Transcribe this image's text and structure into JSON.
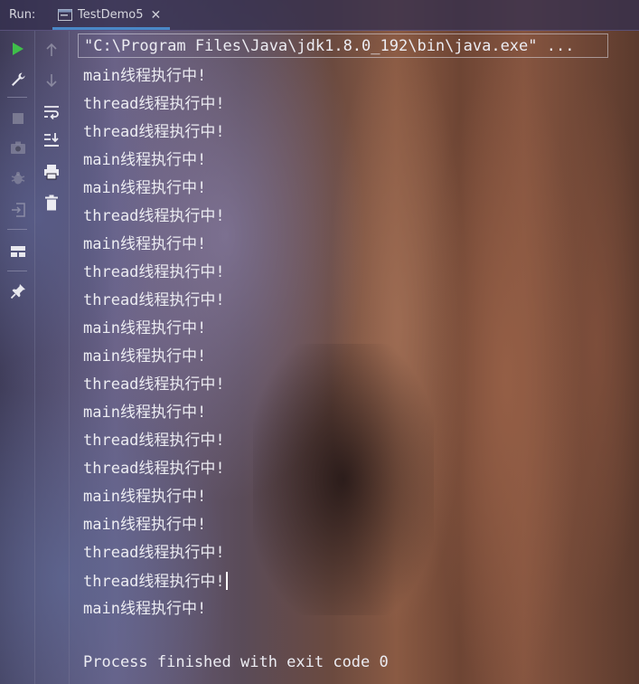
{
  "titlebar": {
    "run_label": "Run:",
    "tab": {
      "label": "TestDemo5",
      "icon": "console-window-icon",
      "close": "✕"
    }
  },
  "toolbar_left": [
    {
      "icon": "run-icon",
      "color": "#3fbf4a"
    },
    {
      "icon": "wrench-icon"
    },
    {
      "icon": "stop-icon"
    },
    {
      "icon": "camera-icon"
    },
    {
      "icon": "bug-icon"
    },
    {
      "icon": "exit-icon"
    },
    {
      "icon": "layout-icon"
    },
    {
      "icon": "pin-icon"
    }
  ],
  "toolbar_right": [
    {
      "icon": "arrow-up-icon"
    },
    {
      "icon": "arrow-down-icon"
    },
    {
      "icon": "soft-wrap-icon"
    },
    {
      "icon": "scroll-to-end-icon"
    },
    {
      "icon": "print-icon"
    },
    {
      "icon": "trash-icon"
    }
  ],
  "console": {
    "command": "\"C:\\Program Files\\Java\\jdk1.8.0_192\\bin\\java.exe\" ...",
    "lines": [
      "main线程执行中!",
      "thread线程执行中!",
      "thread线程执行中!",
      "main线程执行中!",
      "main线程执行中!",
      "thread线程执行中!",
      "main线程执行中!",
      "thread线程执行中!",
      "thread线程执行中!",
      "main线程执行中!",
      "main线程执行中!",
      "thread线程执行中!",
      "main线程执行中!",
      "thread线程执行中!",
      "thread线程执行中!",
      "main线程执行中!",
      "main线程执行中!",
      "thread线程执行中!",
      "thread线程执行中!",
      "main线程执行中!"
    ],
    "exit_message": "Process finished with exit code 0"
  },
  "colors": {
    "accent": "#4a88c7",
    "run_green": "#3fbf4a"
  }
}
